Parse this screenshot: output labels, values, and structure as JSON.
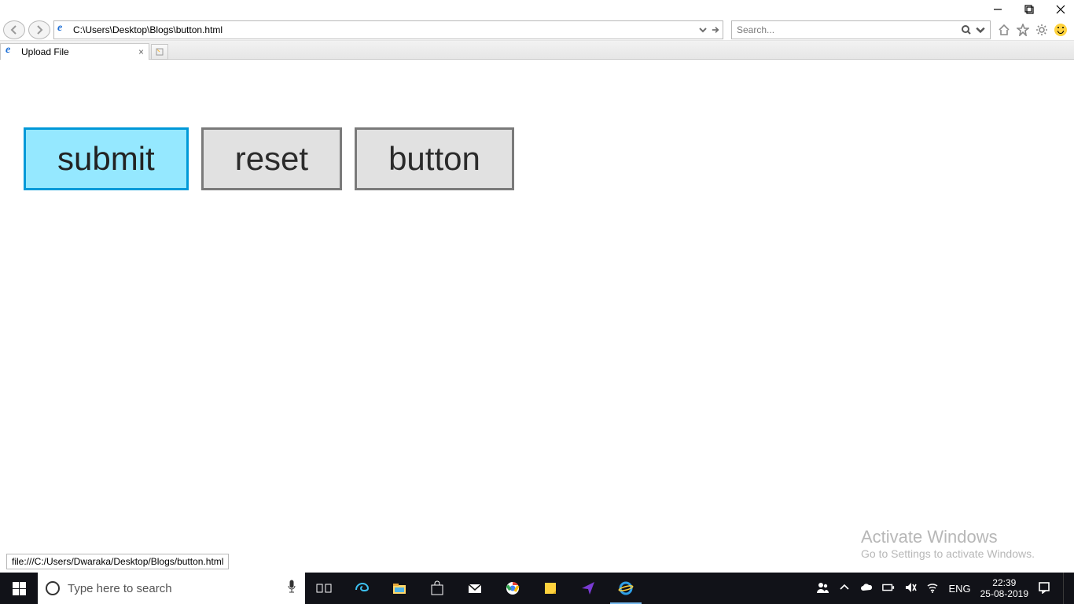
{
  "window": {
    "minimize": "–",
    "maximize": "❐",
    "close": "✕"
  },
  "browser": {
    "url": "C:\\Users\\Desktop\\Blogs\\button.html",
    "search_placeholder": "Search...",
    "tab_title": "Upload File",
    "status_url": "file:///C:/Users/Dwaraka/Desktop/Blogs/button.html"
  },
  "page": {
    "buttons": {
      "submit": "submit",
      "reset": "reset",
      "button": "button"
    }
  },
  "watermark": {
    "line1": "Activate Windows",
    "line2": "Go to Settings to activate Windows."
  },
  "taskbar": {
    "search_placeholder": "Type here to search",
    "lang": "ENG",
    "time": "22:39",
    "date": "25-08-2019"
  }
}
